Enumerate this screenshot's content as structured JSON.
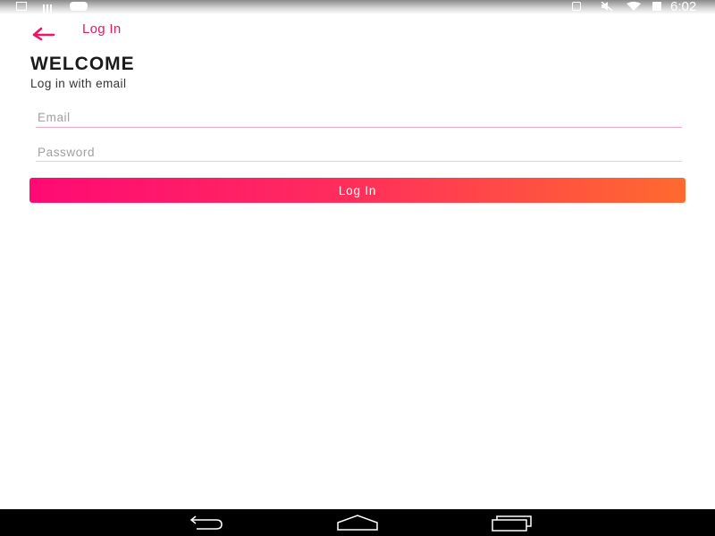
{
  "status_bar": {
    "time": "6:02",
    "icons": [
      "download-icon",
      "signal-bars-icon",
      "youtube-icon",
      "sim-icon",
      "mute-icon",
      "wifi-icon",
      "battery-icon"
    ]
  },
  "topbar": {
    "back_icon": "arrow-left-icon",
    "title": "Log In"
  },
  "main": {
    "heading": "WELCOME",
    "subtitle": "Log in with email",
    "email": {
      "placeholder": "Email",
      "value": ""
    },
    "password": {
      "placeholder": "Password",
      "value": ""
    },
    "login_button_label": "Log In"
  },
  "navigation_bar": {
    "buttons": [
      "back-icon",
      "home-icon",
      "recents-icon"
    ]
  },
  "colors": {
    "accent": "#ee1466",
    "button_gradient_start": "#ff0a74",
    "button_gradient_end": "#ff6a2e",
    "nav_bar": "#000000"
  }
}
